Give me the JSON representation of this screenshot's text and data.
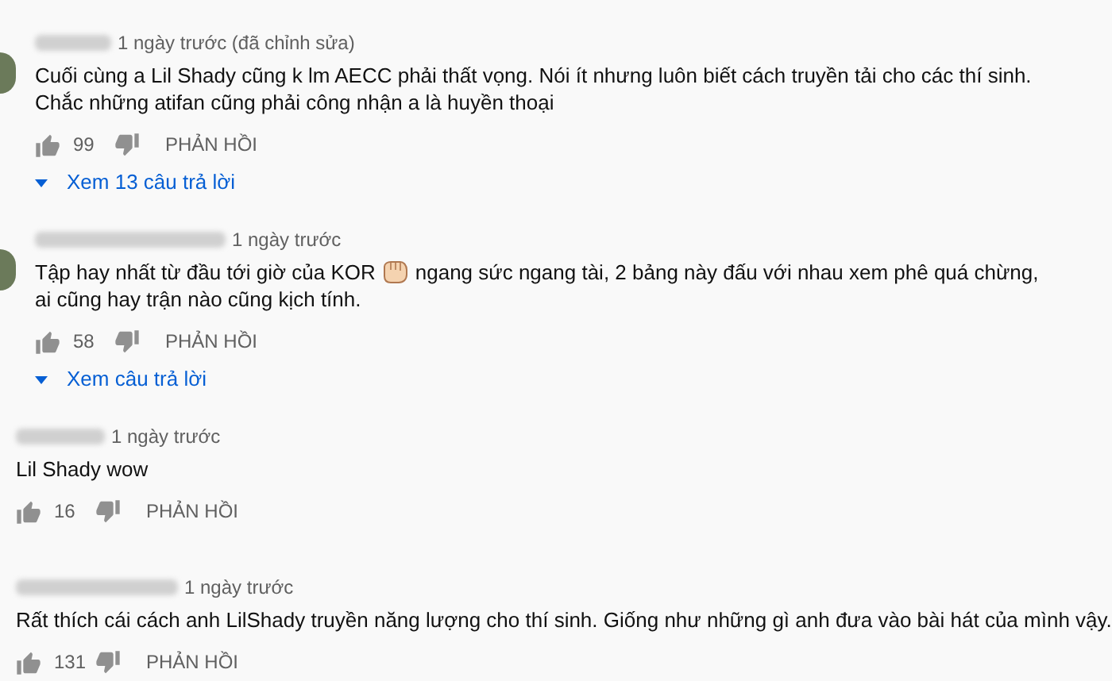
{
  "comments": [
    {
      "kind": "with-avatar",
      "time": "1 ngày trước (đã chỉnh sửa)",
      "body": [
        "Cuối cùng a Lil Shady cũng k lm AECC phải thất vọng. Nói ít nhưng luôn biết cách truyền tải cho các thí sinh. Chắc những atifan cũng phải công nhận a là huyền thoại"
      ],
      "likes": "99",
      "reply": "PHẢN HỒI",
      "replies_link": "Xem 13 câu trả lời"
    },
    {
      "kind": "with-avatar",
      "time": "1 ngày trước",
      "body": [
        "Tập hay nhất từ đầu tới giờ của KOR",
        "ngang sức ngang tài, 2 bảng này đấu với nhau xem phê quá chừng, ai cũng hay trận nào cũng kịch tính."
      ],
      "likes": "58",
      "reply": "PHẢN HỒI",
      "replies_link": "Xem câu trả lời"
    },
    {
      "kind": "plain",
      "time": "1 ngày trước",
      "body": [
        "Lil Shady wow"
      ],
      "likes": "16",
      "reply": "PHẢN HỒI"
    },
    {
      "kind": "plain",
      "time": "1 ngày trước",
      "body": [
        "Rất thích cái cách anh LilShady truyền năng lượng cho thí sinh. Giống như những gì anh đưa vào bài hát của mình vậy."
      ],
      "likes": "131",
      "reply": "PHẢN HỒI"
    }
  ]
}
